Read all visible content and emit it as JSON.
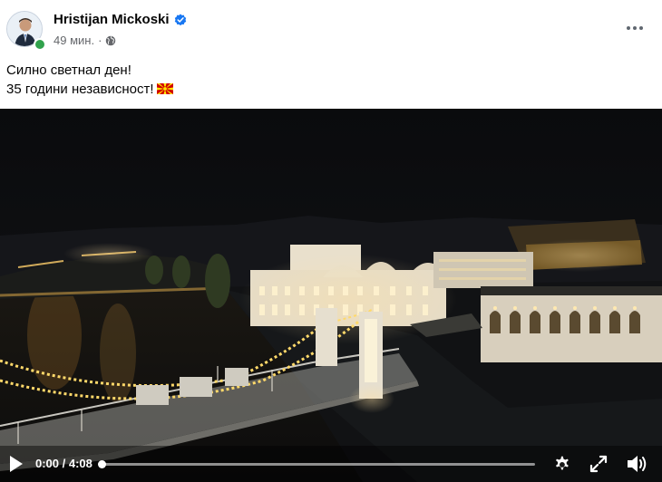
{
  "post": {
    "author": "Hristijan Mickoski",
    "timestamp": "49 мин.",
    "separator": "·",
    "text_line1": "Силно светнал ден!",
    "text_line2": "35 години независност!",
    "icons": {
      "verified": "verified-badge-icon",
      "audience": "globe-icon",
      "menu": "more-options-icon",
      "flag": "north-macedonia-flag-icon"
    }
  },
  "video": {
    "time_display": "0:00 / 4:08",
    "progress_fraction": 0,
    "icons": {
      "play": "play-icon",
      "settings": "gear-icon",
      "fullscreen": "fullscreen-icon",
      "volume": "volume-icon"
    }
  },
  "colors": {
    "verified": "#1877f2",
    "online": "#31a24c",
    "flag_red": "#d20000",
    "flag_yellow": "#ffe600",
    "text_secondary": "#65676b"
  }
}
